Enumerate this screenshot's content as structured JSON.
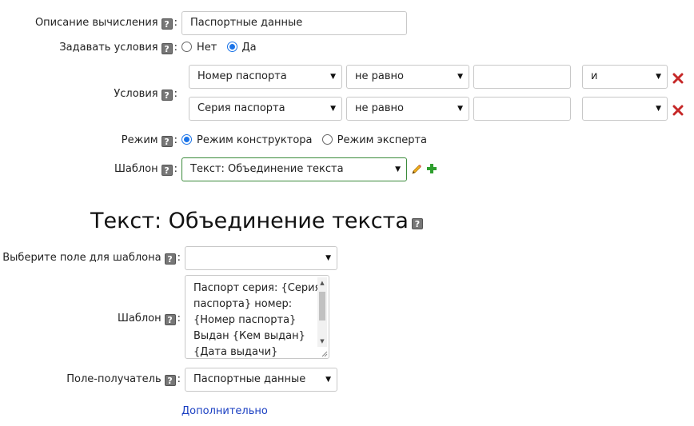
{
  "form": {
    "description": {
      "label": "Описание вычисления",
      "value": "Паспортные данные"
    },
    "set_conditions": {
      "label": "Задавать условия",
      "options": [
        "Нет",
        "Да"
      ],
      "selected": "Да"
    },
    "conditions": {
      "label": "Условия",
      "rows": [
        {
          "field": "Номер паспорта",
          "operator": "не равно",
          "value": "",
          "join": "и"
        },
        {
          "field": "Серия паспорта",
          "operator": "не равно",
          "value": "",
          "join": ""
        }
      ]
    },
    "mode": {
      "label": "Режим",
      "options": [
        "Режим конструктора",
        "Режим эксперта"
      ],
      "selected": "Режим конструктора"
    },
    "template": {
      "label": "Шаблон",
      "value": "Текст: Объединение текста"
    }
  },
  "section": {
    "title": "Текст: Объединение текста",
    "field_select": {
      "label": "Выберите поле для шаблона",
      "value": ""
    },
    "template_text": {
      "label": "Шаблон",
      "lines": [
        "Паспорт серия: {Серия",
        "паспорта} номер:",
        "{Номер паспорта}",
        "Выдан {Кем выдан}",
        "{Дата выдачи}"
      ]
    },
    "target_field": {
      "label": "Поле-получатель",
      "value": "Паспортные данные"
    },
    "more_link": "Дополнительно"
  },
  "ui": {
    "help_glyph": "?",
    "colon": ":",
    "dropdown_arrow": "▼"
  },
  "icons": {
    "remove": "x-icon",
    "edit": "pencil-icon",
    "add": "plus-icon",
    "help": "question-icon"
  },
  "colors": {
    "remove": "#c62828",
    "add": "#2e9e2e",
    "radio": "#1a73e8",
    "link": "#1a3fc2",
    "active_border": "#3a8a3a"
  }
}
